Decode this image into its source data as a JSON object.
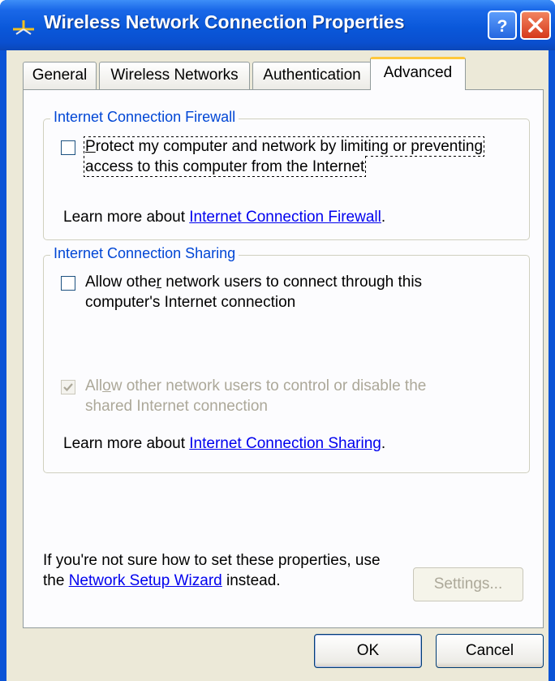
{
  "window": {
    "title": "Wireless Network Connection Properties"
  },
  "tabs": [
    {
      "label": "General"
    },
    {
      "label": "Wireless Networks"
    },
    {
      "label": "Authentication"
    },
    {
      "label": "Advanced",
      "selected": true
    }
  ],
  "firewall": {
    "group_label": "Internet Connection Firewall",
    "checkbox_line1": "rotect my computer and network by limiting or preventing",
    "checkbox_line1_accel": "P",
    "checkbox_line2": "access to this computer from the Internet",
    "checkbox_checked": false,
    "learn_prefix": "Learn more about ",
    "learn_link": "Internet Connection Firewall",
    "learn_suffix": "."
  },
  "sharing": {
    "group_label": "Internet Connection Sharing",
    "allow_connect_pre": "Allow othe",
    "allow_connect_accel": "r",
    "allow_connect_post": " network users to connect through this",
    "allow_connect_line2": "computer's Internet connection",
    "allow_connect_checked": false,
    "allow_control_pre": "All",
    "allow_control_accel": "o",
    "allow_control_post": "w other network users to control or disable the",
    "allow_control_line2": "shared Internet connection",
    "allow_control_checked": true,
    "allow_control_enabled": false,
    "learn_prefix": "Learn more about ",
    "learn_link": "Internet Connection Sharing",
    "learn_suffix": "."
  },
  "footer": {
    "hint_line1": "If you're not sure how to set these properties, use",
    "hint_line2_prefix": "the ",
    "hint_link": "Network Setup Wizard",
    "hint_line2_suffix": " instead.",
    "settings_button": "Settings...",
    "settings_enabled": false
  },
  "buttons": {
    "ok": "OK",
    "cancel": "Cancel"
  },
  "icons": {
    "title": "network-connection-icon",
    "help": "help-icon",
    "close": "close-icon",
    "check": "checkmark-icon"
  },
  "colors": {
    "titlebar": "#0a58da",
    "group_label": "#0046d5",
    "link": "#0000ee",
    "tab_highlight": "#ffc83c",
    "disabled_text": "#aca899"
  }
}
